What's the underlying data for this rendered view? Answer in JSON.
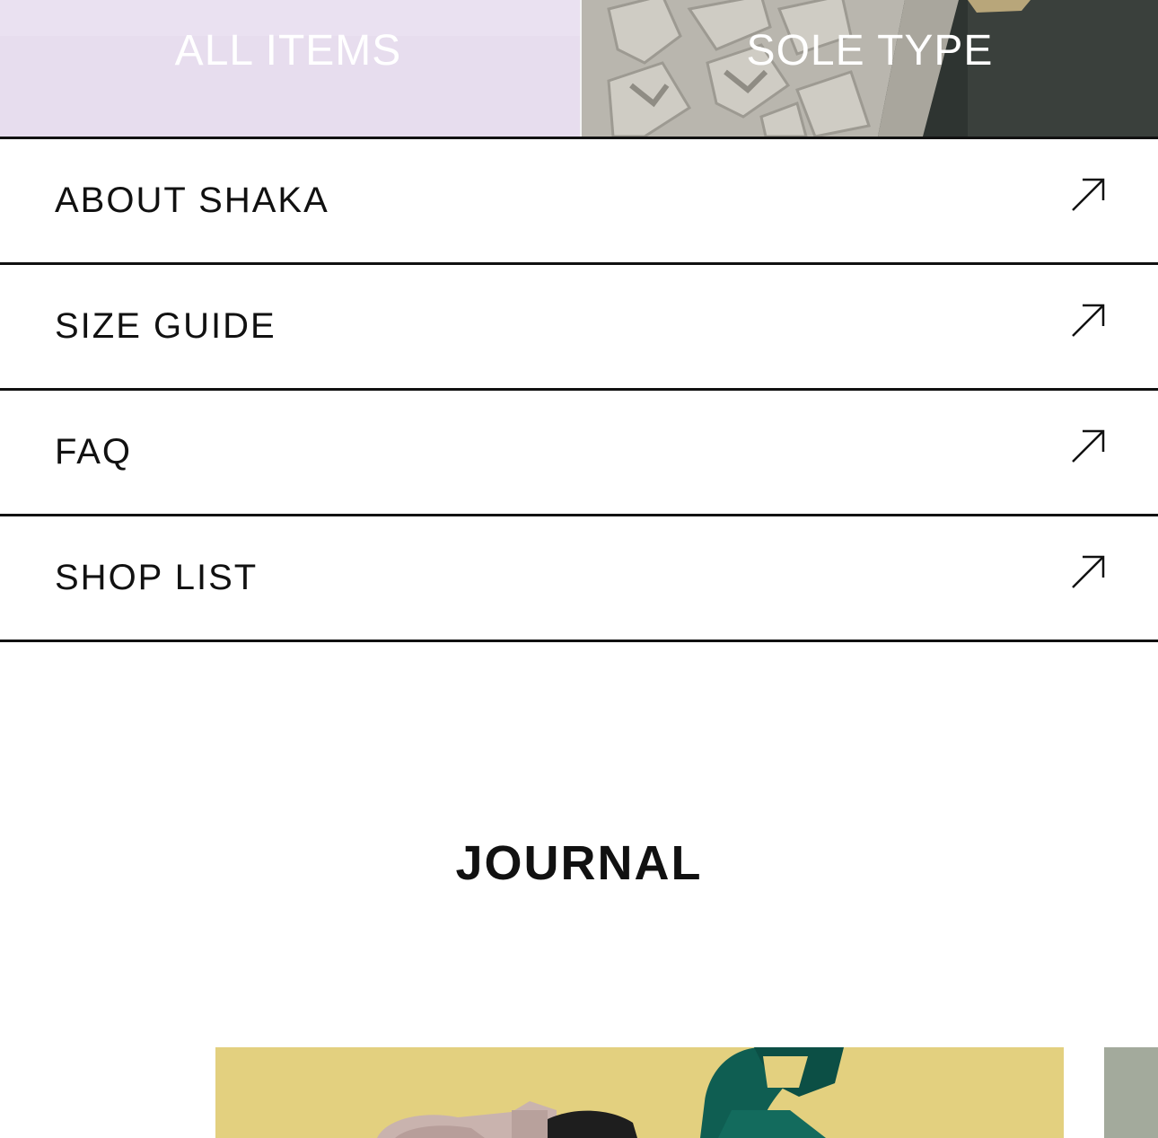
{
  "tiles": {
    "all_items": {
      "label": "ALL ITEMS"
    },
    "sole_type": {
      "label": "SOLE TYPE"
    }
  },
  "menu": {
    "items": [
      {
        "label": "ABOUT SHAKA",
        "icon": "arrow-up-right-icon"
      },
      {
        "label": "SIZE GUIDE",
        "icon": "arrow-up-right-icon"
      },
      {
        "label": "FAQ",
        "icon": "arrow-up-right-icon"
      },
      {
        "label": "SHOP LIST",
        "icon": "arrow-up-right-icon"
      }
    ]
  },
  "journal": {
    "title": "JOURNAL"
  },
  "colors": {
    "text": "#111111",
    "tile_all_bg": "#e6dced",
    "tile_sole_bg": "#2a2f2c",
    "journal_card_bg": "#e4d17e"
  }
}
